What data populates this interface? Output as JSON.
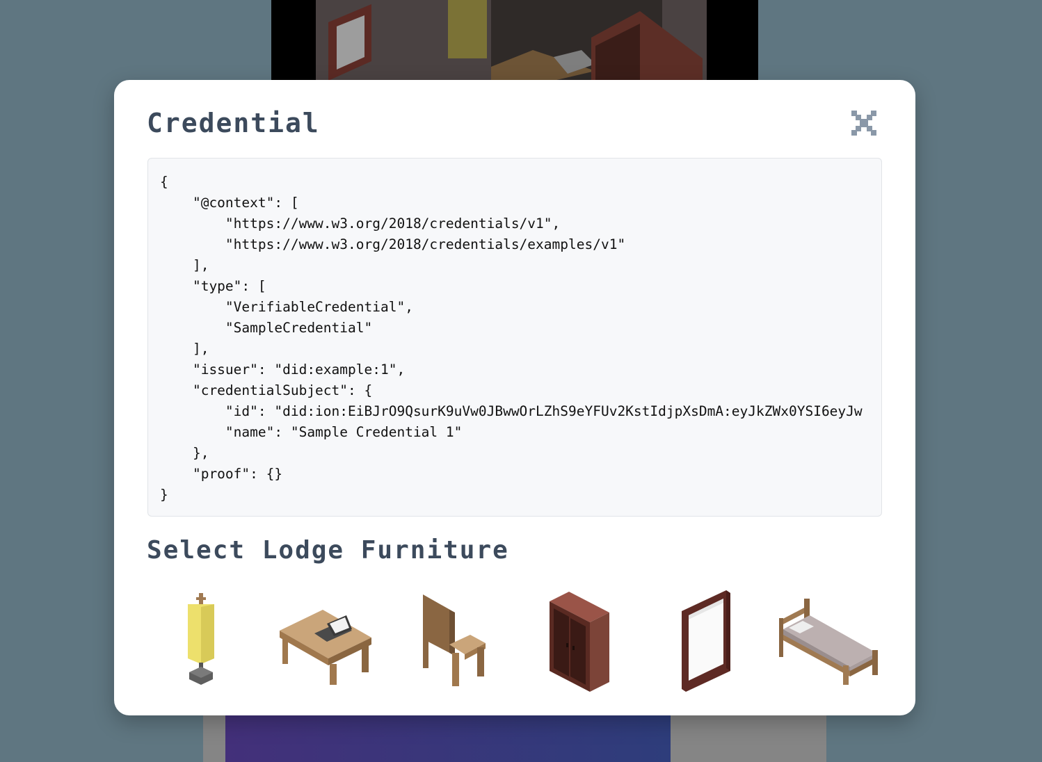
{
  "modal": {
    "title": "Credential",
    "credential_json": "{\n    \"@context\": [\n        \"https://www.w3.org/2018/credentials/v1\",\n        \"https://www.w3.org/2018/credentials/examples/v1\"\n    ],\n    \"type\": [\n        \"VerifiableCredential\",\n        \"SampleCredential\"\n    ],\n    \"issuer\": \"did:example:1\",\n    \"credentialSubject\": {\n        \"id\": \"did:ion:EiBJrO9QsurK9uVw0JBwwOrLZhS9eYFUv2KstIdjpXsDmA:eyJkZWx0YSI6eyJw\n        \"name\": \"Sample Credential 1\"\n    },\n    \"proof\": {}\n}",
    "close_icon": "close-icon"
  },
  "furniture": {
    "title": "Select Lodge Furniture",
    "items": [
      {
        "name": "lamp",
        "icon": "lamp-icon"
      },
      {
        "name": "desk",
        "icon": "desk-icon"
      },
      {
        "name": "chair",
        "icon": "chair-icon"
      },
      {
        "name": "wardrobe",
        "icon": "wardrobe-icon"
      },
      {
        "name": "mirror",
        "icon": "mirror-icon"
      },
      {
        "name": "bed",
        "icon": "bed-icon"
      }
    ]
  },
  "colors": {
    "backdrop": "#5f7681",
    "title_text": "#3c4a5c",
    "code_background": "#f7f8fa"
  }
}
